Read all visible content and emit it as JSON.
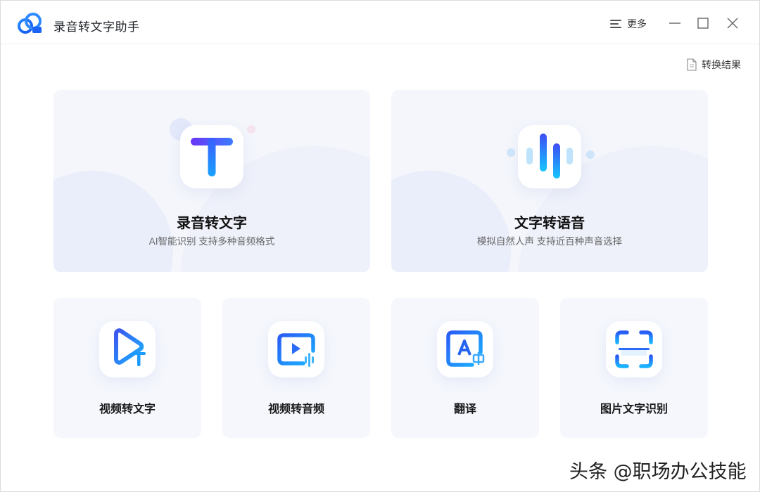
{
  "app": {
    "title": "录音转文字助手",
    "logo_icon": "cloud-logo-icon",
    "accent_color": "#1a6bff"
  },
  "titlebar": {
    "more_label": "更多",
    "more_icon": "menu-lines-icon",
    "minimize_icon": "minimize-icon",
    "maximize_icon": "maximize-icon",
    "close_icon": "close-icon"
  },
  "toolbar": {
    "result_label": "转换结果",
    "result_icon": "document-icon"
  },
  "main_features": [
    {
      "title": "录音转文字",
      "subtitle": "AI智能识别 支持多种音频格式",
      "icon": "text-t-icon"
    },
    {
      "title": "文字转语音",
      "subtitle": "模拟自然人声 支持近百种声音选择",
      "icon": "sound-wave-icon"
    }
  ],
  "tools": [
    {
      "title": "视频转文字",
      "icon": "video-to-text-icon"
    },
    {
      "title": "视频转音频",
      "icon": "video-to-audio-icon"
    },
    {
      "title": "翻译",
      "icon": "translate-icon"
    },
    {
      "title": "图片文字识别",
      "icon": "scan-ocr-icon"
    }
  ],
  "watermark": "头条 @职场办公技能"
}
